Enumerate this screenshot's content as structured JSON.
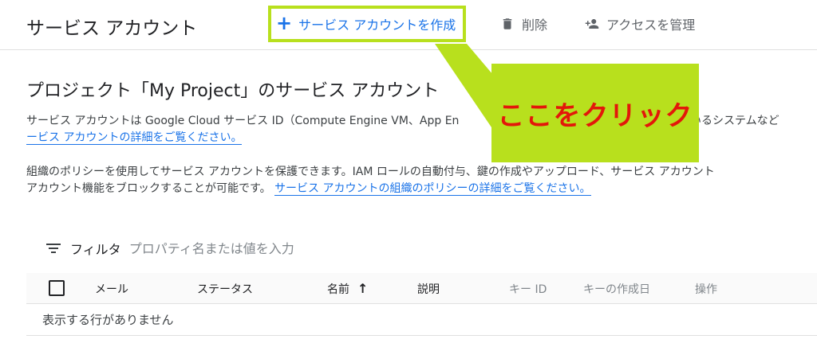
{
  "header": {
    "title": "サービス アカウント",
    "create_label": "サービス アカウントを作成",
    "delete_label": "削除",
    "manage_access_label": "アクセスを管理"
  },
  "main": {
    "heading": "プロジェクト「My Project」のサービス アカウント",
    "intro_line1": "サービス アカウントは Google Cloud サービス ID（Compute Engine VM、App En",
    "intro_line1_tail": "れているシステムなど",
    "intro_link": "ービス アカウントの詳細をご覧ください。",
    "policy_line1": "組織のポリシーを使用してサービス アカウントを保護できます。IAM ロールの自動付与、鍵の作成やアップロード、サービス アカウント",
    "policy_line2": "アカウント機能をブロックすることが可能です。",
    "policy_link": "サービス アカウントの組織のポリシーの詳細をご覧ください。"
  },
  "annotation": {
    "callout_text": "ここをクリック",
    "highlight_color": "#b8e01d",
    "text_color": "#e3170a"
  },
  "filter": {
    "label": "フィルタ",
    "placeholder": "プロパティ名または値を入力"
  },
  "table": {
    "columns": {
      "email": "メール",
      "status": "ステータス",
      "name": "名前",
      "description": "説明",
      "key_id": "キー ID",
      "key_created": "キーの作成日",
      "actions": "操作"
    },
    "empty_message": "表示する行がありません"
  },
  "icons": [
    "plus-icon",
    "trash-icon",
    "add-person-icon",
    "filter-icon",
    "arrow-up-icon"
  ]
}
